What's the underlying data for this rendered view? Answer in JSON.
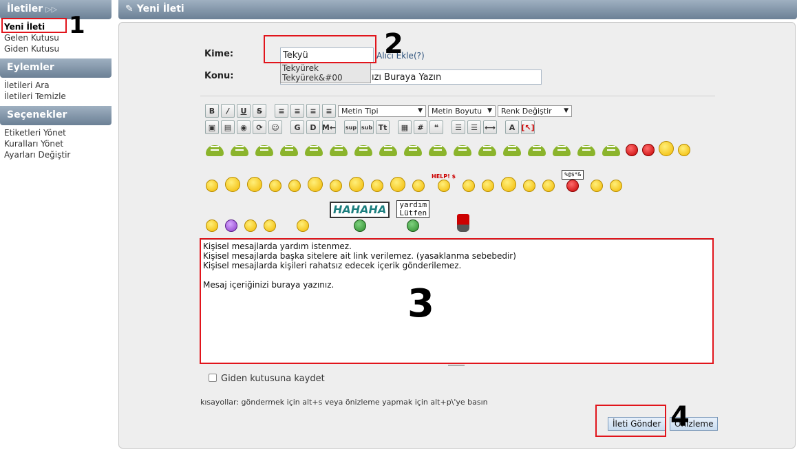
{
  "sidebar": {
    "messages_header": "İletiler",
    "messages_items": [
      "Yeni İleti",
      "Gelen Kutusu",
      "Giden Kutusu"
    ],
    "actions_header": "Eylemler",
    "actions_items": [
      "İletileri Ara",
      "İletileri Temizle"
    ],
    "options_header": "Seçenekler",
    "options_items": [
      "Etiketleri Yönet",
      "Kuralları Yönet",
      "Ayarları Değiştir"
    ]
  },
  "main": {
    "title": "Yeni İleti",
    "to_label": "Kime:",
    "to_value": "Tekyü",
    "add_recipient": "Alıcı Ekle",
    "help": "(?)",
    "subject_label": "Konu:",
    "subject_value": "ızı Buraya Yazın",
    "suggestions": [
      "Tekyürek",
      "Tekyürek&#00"
    ],
    "toolbar": {
      "font_type": "Metin Tipi",
      "font_size": "Metin Boyutu",
      "color": "Renk Değiştir"
    },
    "smiley_signs": {
      "hahaha": "HAHAHA",
      "yardim_1": "yardım",
      "yardim_2": "Lütfen",
      "help": "HELP! $",
      "curse": "%@$*&"
    },
    "message_lines": [
      "Kişisel mesajlarda yardım istenmez.",
      "Kişisel mesajlarda başka sitelere ait link verilemez. (yasaklanma sebebedir)",
      "Kişisel mesajlarda kişileri rahatsız edecek içerik gönderilemez.",
      "",
      "Mesaj içeriğinizi buraya yazınız."
    ],
    "save_outbox": "Giden kutusuna kaydet",
    "shortcuts": "kısayollar: göndermek için alt+s veya önizleme yapmak için alt+p\\'ye basın",
    "send_button": "İleti Gönder",
    "preview_button": "Önizleme"
  },
  "annotations": [
    "1",
    "2",
    "3",
    "4"
  ]
}
